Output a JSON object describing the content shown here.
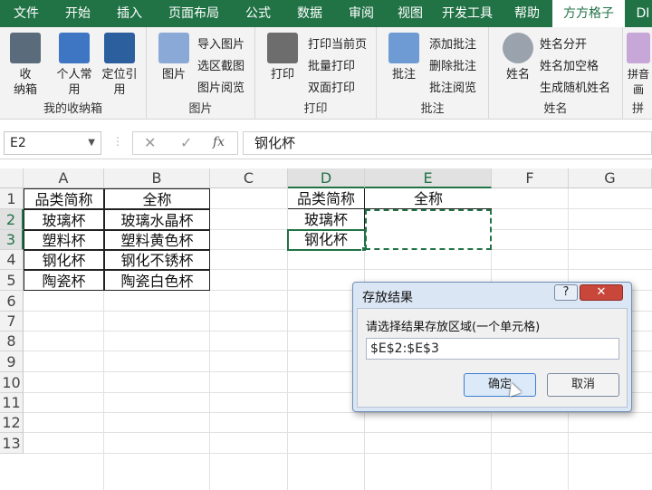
{
  "menu": {
    "tabs": [
      "文件",
      "开始",
      "插入",
      "页面布局",
      "公式",
      "数据",
      "审阅",
      "视图",
      "开发工具",
      "帮助",
      "方方格子",
      "DI"
    ],
    "active_tab": "方方格子"
  },
  "ribbon": {
    "groups": {
      "box": {
        "label": "我的收纳箱",
        "btn1": "收\n纳箱",
        "btn2": "个人常\n用",
        "btn3": "定位引\n用"
      },
      "image": {
        "label": "图片",
        "big": "图片",
        "items": [
          "导入图片",
          "选区截图",
          "图片阅览"
        ]
      },
      "print": {
        "label": "打印",
        "big": "打印",
        "items": [
          "打印当前页",
          "批量打印",
          "双面打印"
        ]
      },
      "comment": {
        "label": "批注",
        "big": "批注",
        "items": [
          "添加批注",
          "删除批注",
          "批注阅览"
        ]
      },
      "name": {
        "label": "姓名",
        "big": "姓名",
        "items": [
          "姓名分开",
          "姓名加空格",
          "生成随机姓名"
        ]
      },
      "pinyin": {
        "label": "拼",
        "big": "拼音\n画"
      }
    }
  },
  "formula_bar": {
    "cell_ref": "E2",
    "fx": "fx",
    "content": "钢化杯"
  },
  "sheet": {
    "columns": [
      "A",
      "B",
      "C",
      "D",
      "E",
      "F",
      "G"
    ],
    "rows": [
      "1",
      "2",
      "3",
      "4",
      "5",
      "6",
      "7",
      "8",
      "9",
      "10",
      "11",
      "12",
      "13"
    ],
    "table1": {
      "headers": [
        "品类简称",
        "全称"
      ],
      "rows": [
        [
          "玻璃杯",
          "玻璃水晶杯"
        ],
        [
          "塑料杯",
          "塑料黄色杯"
        ],
        [
          "钢化杯",
          "钢化不锈杯"
        ],
        [
          "陶瓷杯",
          "陶瓷白色杯"
        ]
      ]
    },
    "table2": {
      "headers": [
        "品类简称",
        "全称"
      ],
      "rows": [
        [
          "玻璃杯",
          ""
        ],
        [
          "钢化杯",
          ""
        ]
      ]
    }
  },
  "dialog": {
    "title": "存放结果",
    "help": "?",
    "close": "✕",
    "prompt": "请选择结果存放区域(一个单元格)",
    "input_value": "$E$2:$E$3",
    "ok": "确定",
    "cancel": "取消"
  }
}
